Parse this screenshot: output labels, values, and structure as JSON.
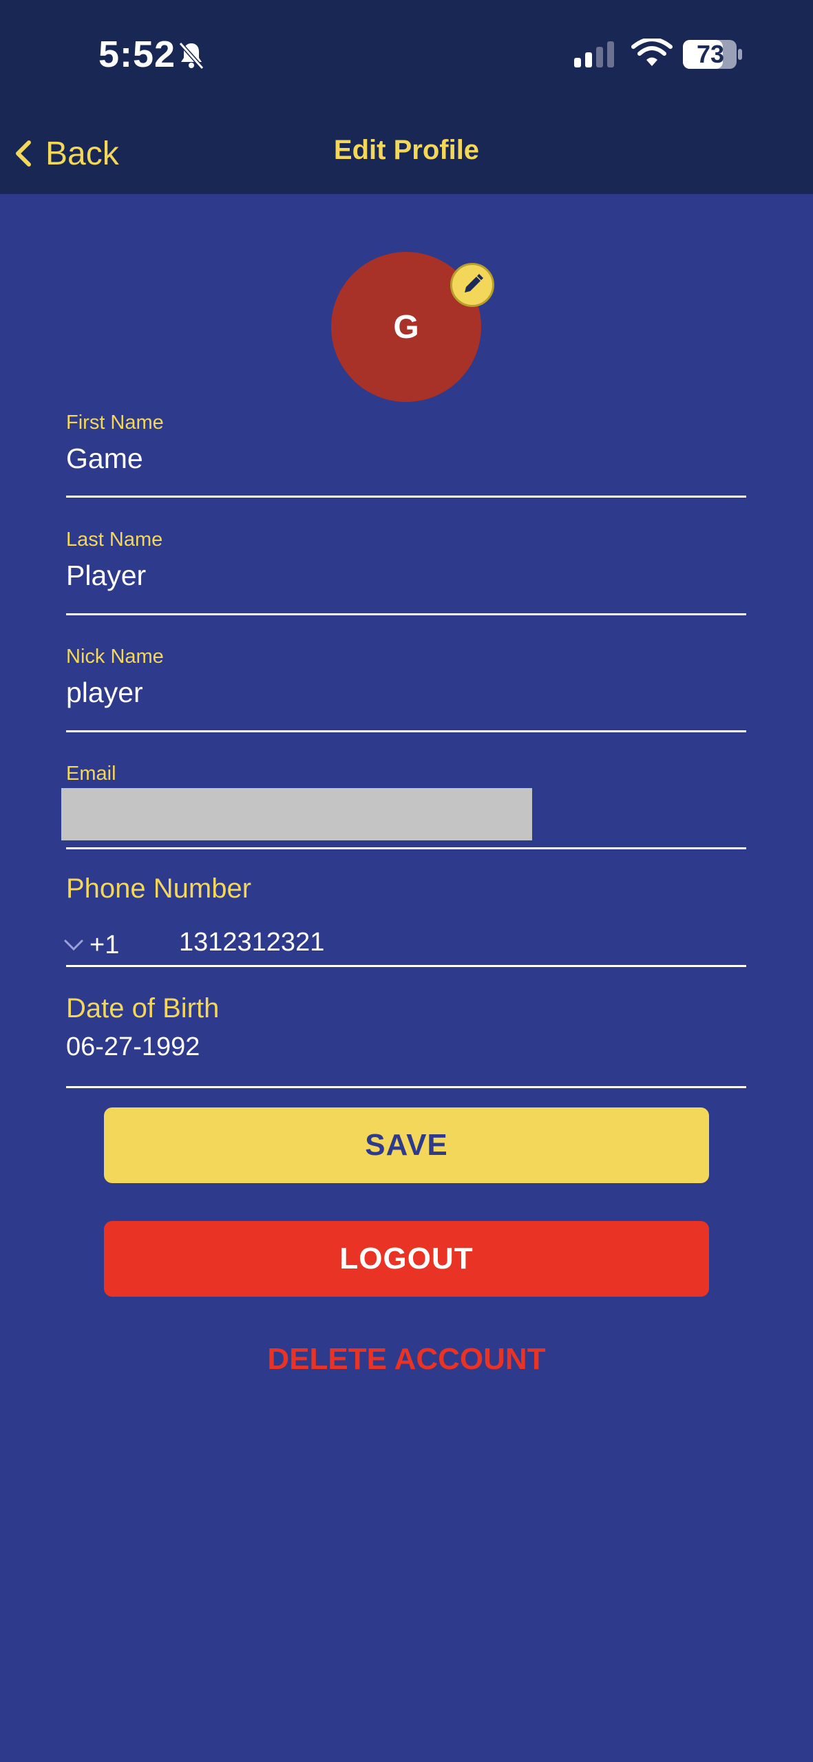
{
  "status_bar": {
    "time": "5:52",
    "battery": "73",
    "icons": [
      "bell-slash-icon",
      "signal-icon",
      "wifi-icon",
      "battery-icon"
    ]
  },
  "header": {
    "back_label": "Back",
    "title": "Edit Profile"
  },
  "avatar": {
    "initial": "G",
    "edit_icon": "pencil-icon"
  },
  "form": {
    "first_name": {
      "label": "First Name",
      "value": "Game"
    },
    "last_name": {
      "label": "Last Name",
      "value": "Player"
    },
    "nick_name": {
      "label": "Nick Name",
      "value": "player"
    },
    "email": {
      "label": "Email"
    },
    "phone": {
      "label": "Phone Number",
      "country_code": "+1",
      "value": "1312312321"
    },
    "dob": {
      "label": "Date of Birth",
      "value": "06-27-1992"
    }
  },
  "actions": {
    "save_label": "SAVE",
    "logout_label": "LOGOUT",
    "delete_label": "DELETE ACCOUNT"
  },
  "colors": {
    "background": "#2e3a8b",
    "header": "#192754",
    "accent_yellow": "#f2d75b",
    "danger_red": "#e93324",
    "avatar_red": "#a83128"
  }
}
